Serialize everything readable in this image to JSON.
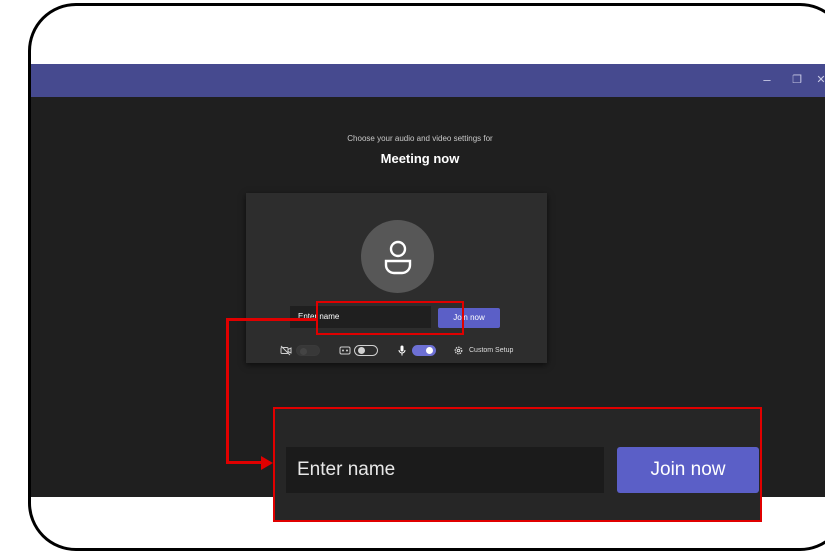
{
  "window": {
    "minimize_glyph": "–",
    "maximize_glyph": "❐",
    "close_glyph": "✕",
    "titlebar_color": "#464a8f"
  },
  "prejoin": {
    "subtitle": "Choose your audio and video settings for",
    "title": "Meeting now",
    "name_input": {
      "placeholder": "Enter name",
      "value": ""
    },
    "join_button": "Join now",
    "controls": {
      "camera": {
        "icon": "camera-off-icon",
        "state": "disabled"
      },
      "blur": {
        "icon": "background-blur-icon",
        "state": "off"
      },
      "mic": {
        "icon": "microphone-icon",
        "state": "on"
      },
      "custom_setup": {
        "icon": "gear-icon",
        "label": "Custom Setup"
      }
    }
  },
  "zoom_callout": {
    "name_input": {
      "placeholder": "Enter name"
    },
    "join_button": "Join now"
  },
  "colors": {
    "accent": "#5b5fc7",
    "highlight": "#e00000",
    "background": "#1f1f1f"
  }
}
